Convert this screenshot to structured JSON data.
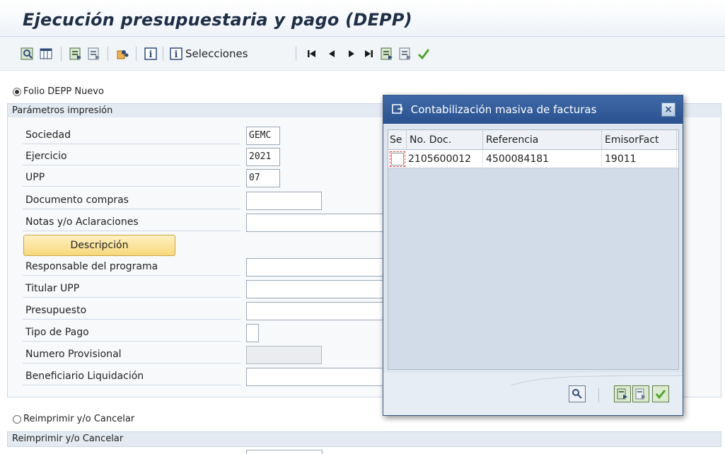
{
  "window": {
    "title": "Ejecución presupuestaria y pago (DEPP)"
  },
  "toolbar": {
    "selections_label": "Selecciones",
    "icons": [
      "execute-icon",
      "layout-icon",
      "select-all-icon",
      "deselect-all-icon",
      "cut-icon",
      "info-icon",
      "info-selections-icon",
      "first-page-icon",
      "previous-page-icon",
      "next-page-icon",
      "last-page-icon",
      "export-icon",
      "import-icon",
      "check-icon"
    ]
  },
  "options": {
    "folio_nuevo": "Folio DEPP Nuevo",
    "reimprimir": "Reimprimir y/o Cancelar"
  },
  "params": {
    "group_title": "Parámetros impresión",
    "fields": [
      {
        "label": "Sociedad",
        "value": "GEMC"
      },
      {
        "label": "Ejercicio",
        "value": "2021"
      },
      {
        "label": "UPP",
        "value": "07"
      },
      {
        "label": "Documento compras",
        "value": ""
      },
      {
        "label": "Notas y/o Aclaraciones",
        "value": ""
      },
      {
        "label": "Responsable del programa",
        "value": ""
      },
      {
        "label": "Titular UPP",
        "value": ""
      },
      {
        "label": "Presupuesto",
        "value": ""
      },
      {
        "label": "Tipo de Pago",
        "value": ""
      },
      {
        "label": "Numero Provisional",
        "value": ""
      },
      {
        "label": "Beneficiario Liquidación",
        "value": ""
      }
    ],
    "description_button": "Descripción"
  },
  "reprint_group": {
    "title": "Reimprimir y/o Cancelar"
  },
  "dialog": {
    "title": "Contabilización masiva de facturas",
    "columns": [
      "Se",
      "No. Doc.",
      "Referencia",
      "EmisorFact"
    ],
    "rows": [
      {
        "doc": "2105600012",
        "ref": "4500084181",
        "emisor": "19011"
      }
    ]
  },
  "colors": {
    "title_bar_dialog": "#2f5a98",
    "accent_yellow": "#f7d87a"
  }
}
